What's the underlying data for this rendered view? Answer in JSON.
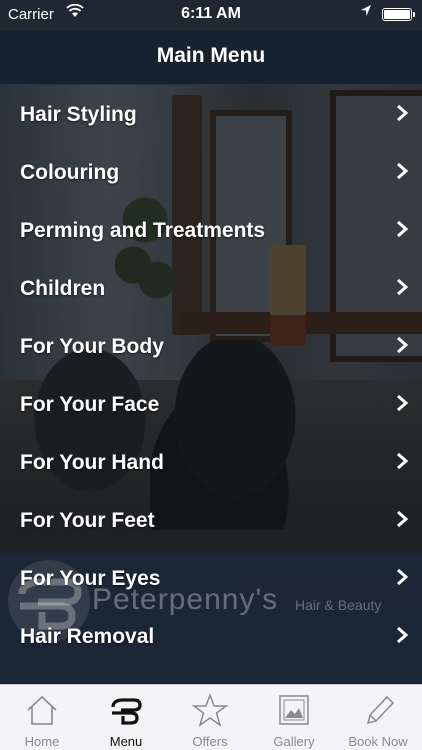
{
  "status_bar": {
    "carrier": "Carrier",
    "time": "6:11 AM"
  },
  "navbar": {
    "title": "Main Menu"
  },
  "menu": {
    "items": [
      {
        "label": "Hair Styling"
      },
      {
        "label": "Colouring"
      },
      {
        "label": "Perming and Treatments"
      },
      {
        "label": "Children"
      },
      {
        "label": "For Your Body"
      },
      {
        "label": "For Your Face"
      },
      {
        "label": "For Your Hand"
      },
      {
        "label": "For Your Feet"
      },
      {
        "label": "For Your Eyes"
      },
      {
        "label": "Hair Removal"
      }
    ]
  },
  "branding": {
    "name": "Peterpenny's",
    "tagline": "Hair & Beauty"
  },
  "tabbar": {
    "tabs": [
      {
        "label": "Home",
        "icon": "home-icon"
      },
      {
        "label": "Menu",
        "icon": "logo-icon"
      },
      {
        "label": "Offers",
        "icon": "star-icon"
      },
      {
        "label": "Gallery",
        "icon": "gallery-icon"
      },
      {
        "label": "Book Now",
        "icon": "pencil-icon"
      }
    ],
    "active": "Menu"
  },
  "colors": {
    "navbar_bg": "#16212f",
    "tabbar_bg": "#f4f4f6",
    "text_primary": "#ffffff",
    "tab_inactive": "#8a8a8e"
  }
}
